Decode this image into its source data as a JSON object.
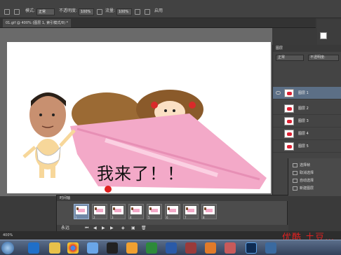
{
  "options_bar": {
    "label_mode": "模式:",
    "mode_value": "正常",
    "label_opacity": "不透明度:",
    "opacity_value": "100%",
    "label_flow": "流量:",
    "flow_value": "100%",
    "checkbox_label": "启用"
  },
  "doc_tab": {
    "title": "01.gif @ 400% (图层 1, 索引模式/8) *"
  },
  "canvas": {
    "caption": "我来了！！"
  },
  "layers_panel": {
    "title": "图层",
    "kind_label": "正常",
    "opacity_label": "不透明度:",
    "layers": [
      {
        "name": "图层 1",
        "selected": true
      },
      {
        "name": "图层 2",
        "selected": false
      },
      {
        "name": "图层 3",
        "selected": false
      },
      {
        "name": "图层 4",
        "selected": false
      },
      {
        "name": "图层 5",
        "selected": false
      }
    ]
  },
  "history_panel": {
    "items": [
      "选择帧",
      "取消选择",
      "自动选择",
      "新建图层"
    ]
  },
  "timeline": {
    "title": "时间轴",
    "frames": [
      "1",
      "2",
      "3",
      "4",
      "5",
      "6",
      "7",
      "8"
    ],
    "selected_frame": 1,
    "loop_label": "永远",
    "frame_delay": "0.1秒"
  },
  "status_bar": {
    "zoom": "400%"
  },
  "watermark": {
    "text": "优酷 土豆…"
  },
  "taskbar": {
    "apps": [
      "ie-icon",
      "explorer-icon",
      "chrome-icon",
      "mail-icon",
      "qq-icon",
      "folder-icon",
      "excel-icon",
      "word-icon",
      "media-icon",
      "music-icon",
      "video-icon",
      "ps-icon",
      "doc-icon"
    ]
  },
  "colors": {
    "accent": "#5c6f86",
    "pink_blanket": "#f3a9c8",
    "watermark_red": "#e02222"
  }
}
